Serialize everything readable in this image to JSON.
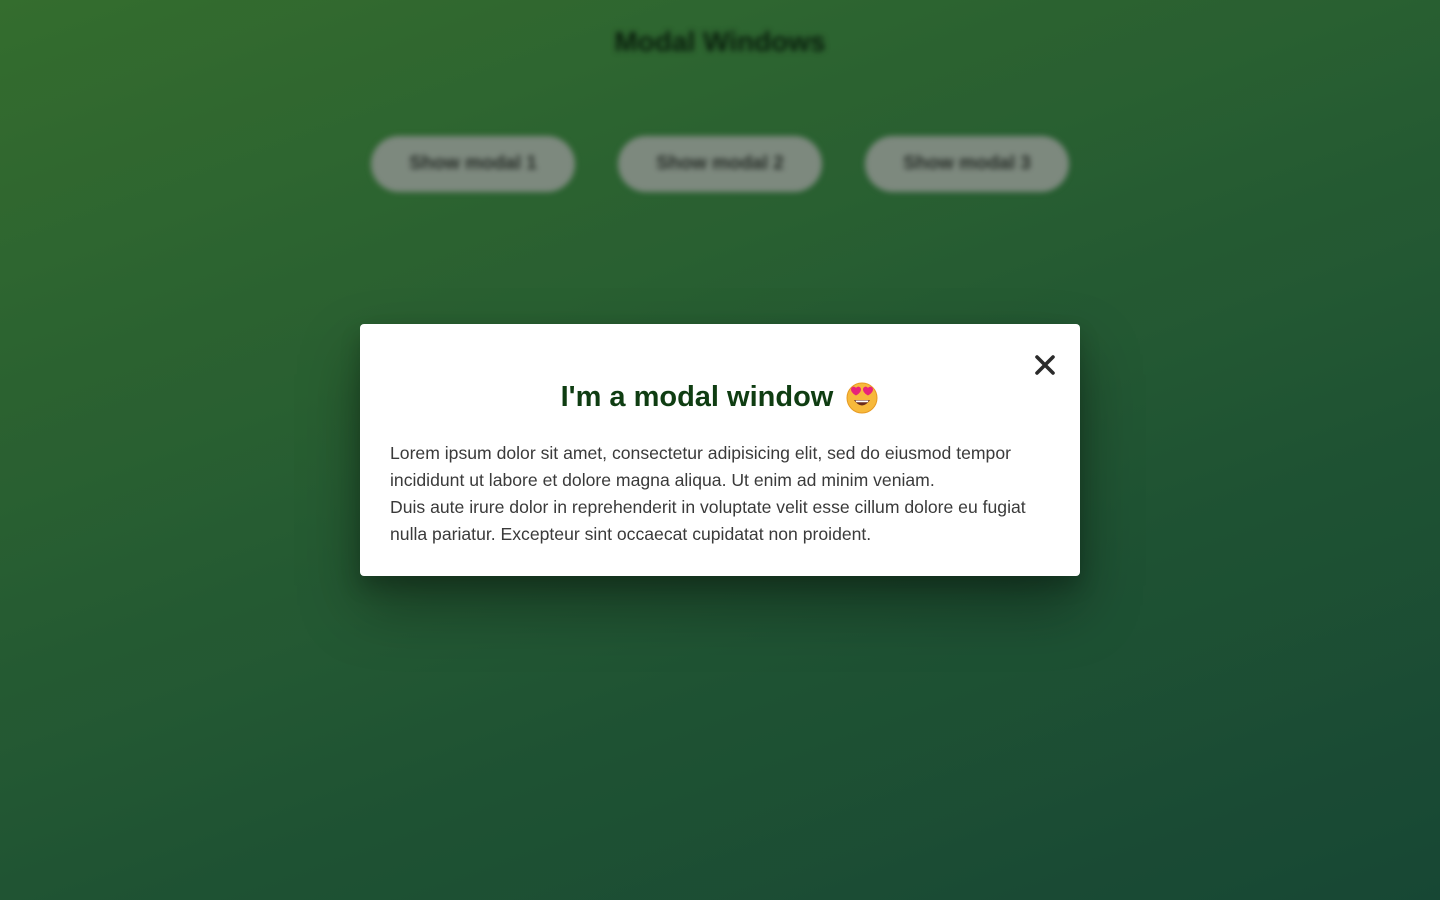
{
  "page": {
    "title": "Modal Windows",
    "buttons": [
      {
        "label": "Show modal 1"
      },
      {
        "label": "Show modal 2"
      },
      {
        "label": "Show modal 3"
      }
    ]
  },
  "modal": {
    "title": "I'm a modal window",
    "emoji_icon": "smiling-face-with-heart-eyes-icon",
    "close_icon": "close-icon",
    "paragraph_1": "Lorem ipsum dolor sit amet, consectetur adipisicing elit, sed do eiusmod tempor incididunt ut labore et dolore magna aliqua. Ut enim ad minim veniam.",
    "paragraph_2": "Duis aute irure dolor in reprehenderit in voluptate velit esse cillum dolore eu fugiat nulla pariatur. Excepteur sint occaecat cupidatat non proident."
  },
  "colors": {
    "background_start": "#3c7a34",
    "background_end": "#1b4f3b",
    "modal_title": "#0f3d12",
    "button_bg": "#8f9a8f",
    "text": "#3a3a3a"
  }
}
